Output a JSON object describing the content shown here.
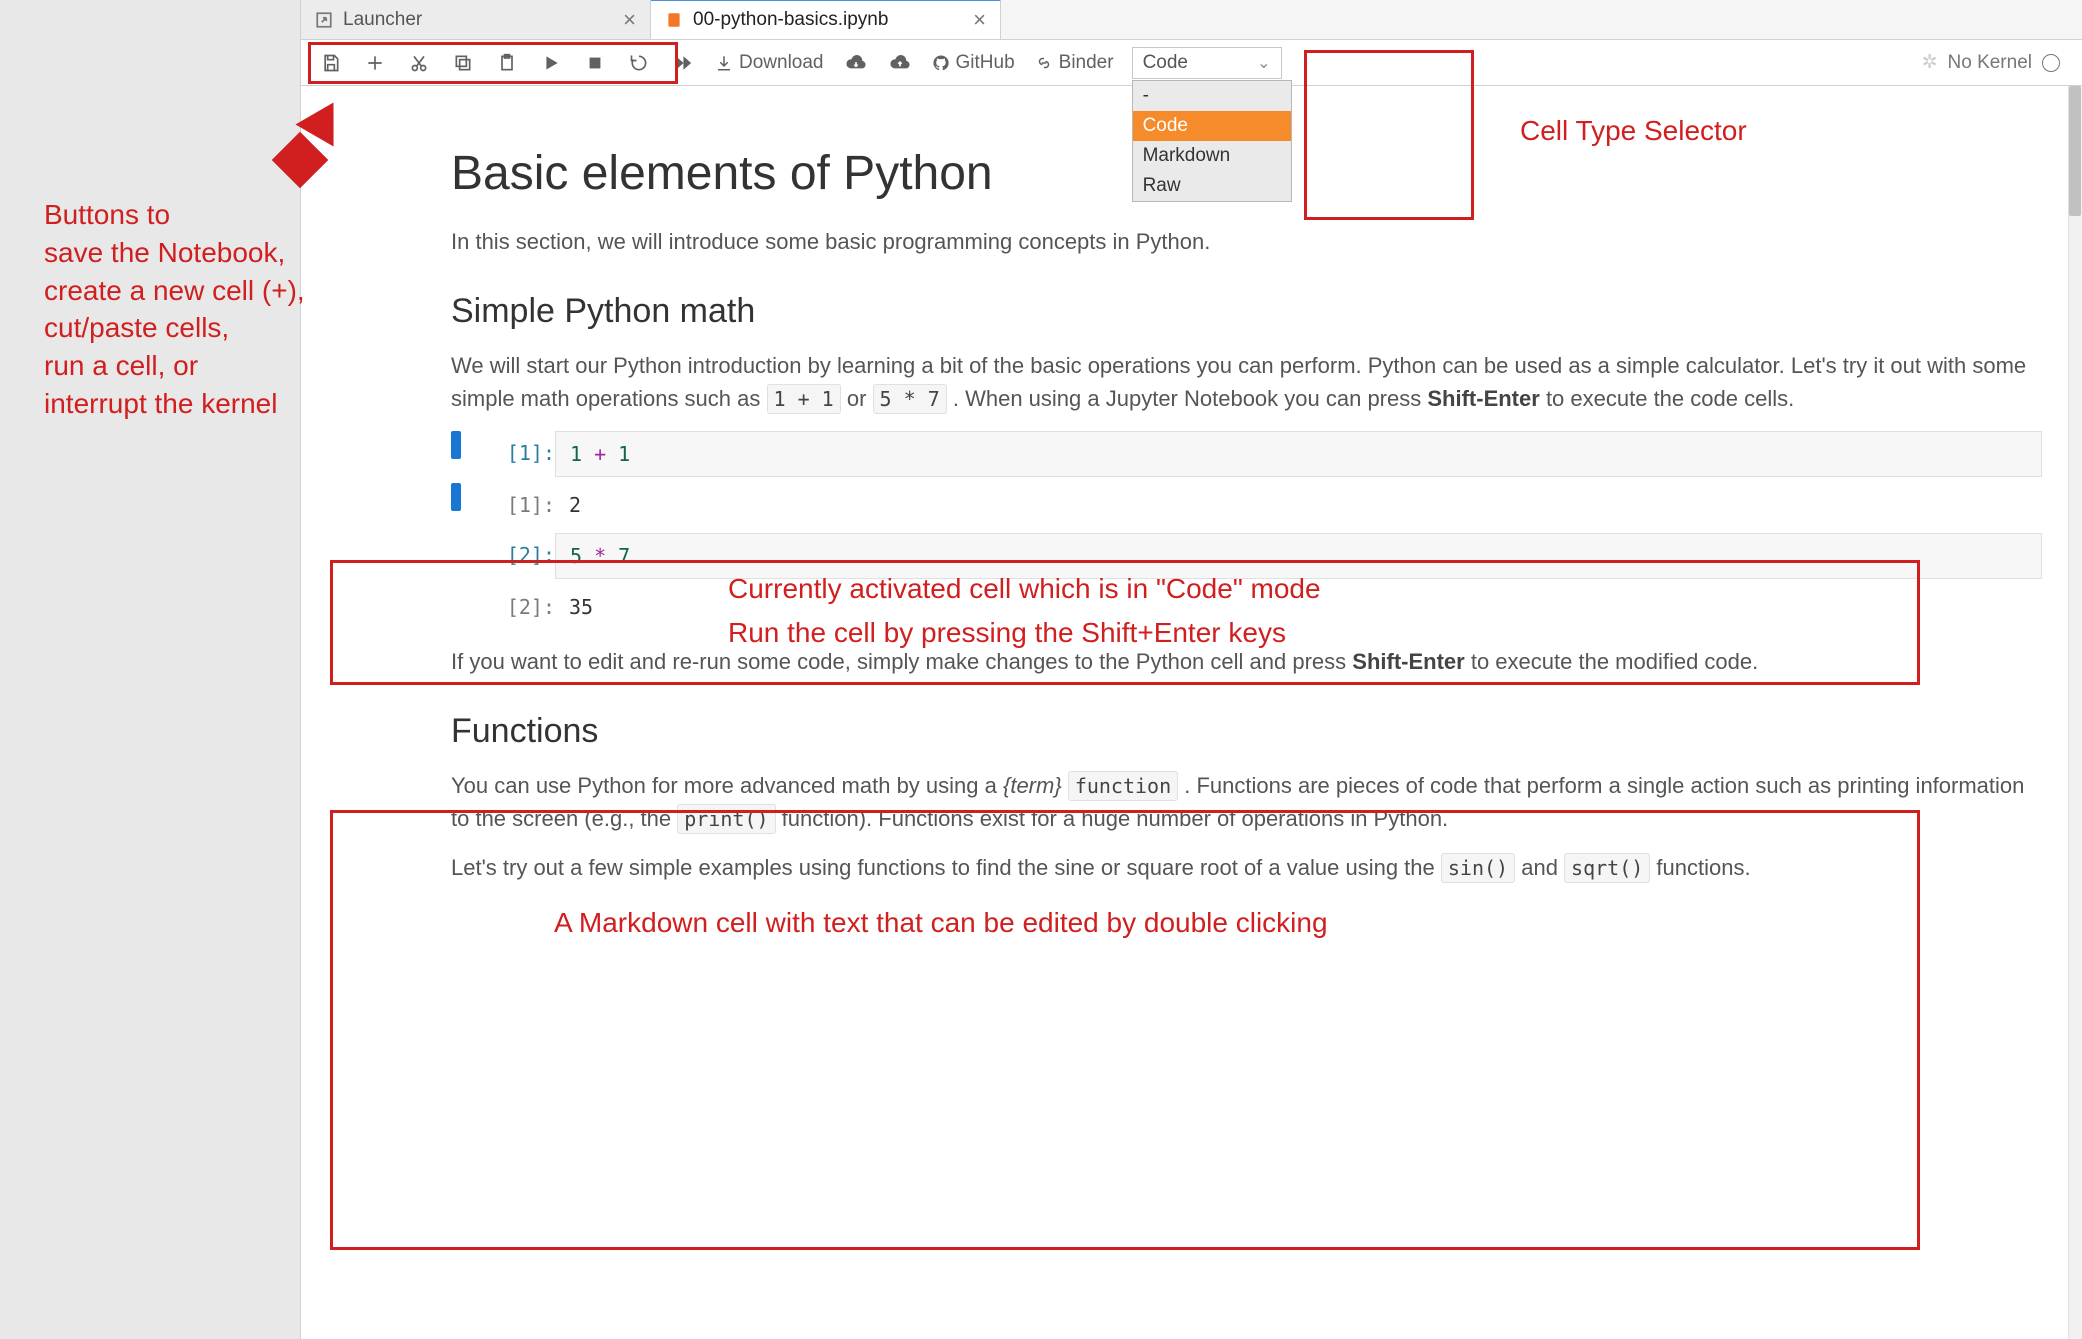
{
  "tabs": [
    {
      "label": "Launcher",
      "icon": "launcher"
    },
    {
      "label": "00-python-basics.ipynb",
      "icon": "notebook"
    }
  ],
  "toolbar": {
    "download_label": "Download",
    "github_label": "GitHub",
    "binder_label": "Binder"
  },
  "celltype": {
    "current": "Code",
    "options": [
      "-",
      "Code",
      "Markdown",
      "Raw"
    ]
  },
  "kernel": {
    "status": "No Kernel"
  },
  "content": {
    "h1": "Basic elements of Python",
    "p1": "In this section, we will introduce some basic programming concepts in Python.",
    "h2a": "Simple Python math",
    "p2_pre": "We will start our Python introduction by learning a bit of the basic operations you can perform. Python can be used as a simple calculator. Let's try it out with some simple math operations such as ",
    "code1": "1 + 1",
    "p2_mid": " or ",
    "code2": "5 * 7",
    "p2_post": " . When using a Jupyter Notebook you can press ",
    "bold1": "Shift-Enter",
    "p2_end": " to execute the code cells.",
    "cell1_in_prompt": "[1]:",
    "cell1_in_code_a": "1",
    "cell1_in_code_op": " + ",
    "cell1_in_code_b": "1",
    "cell1_out_prompt": "[1]:",
    "cell1_out": "2",
    "cell2_in_prompt": "[2]:",
    "cell2_in_code_a": "5",
    "cell2_in_code_op": " * ",
    "cell2_in_code_b": "7",
    "cell2_out_prompt": "[2]:",
    "cell2_out": "35",
    "p3_pre": "If you want to edit and re-run some code, simply make changes to the Python cell and press ",
    "bold2": "Shift-Enter",
    "p3_post": " to execute the modified code.",
    "h2b": "Functions",
    "p4_pre": "You can use Python for more advanced math by using a ",
    "term": "{term}",
    "code_func": "function",
    "p4_mid": " . Functions are pieces of code that perform a single action such as printing information to the screen (e.g., the ",
    "code_print": "print()",
    "p4_post": " function). Functions exist for a huge number of operations in Python.",
    "p5_pre": "Let's try out a few simple examples using functions to find the sine or square root of a value using the ",
    "code_sin": "sin()",
    "p5_mid": " and ",
    "code_sqrt": "sqrt()",
    "p5_post": " functions."
  },
  "annotations": {
    "toolbar_buttons": "Buttons to\nsave the Notebook,\ncreate a new cell (+),\ncut/paste cells,\nrun a cell, or\ninterrupt the kernel",
    "celltype_label": "Cell Type Selector",
    "active_cell_a": "Currently activated cell which is in \"Code\" mode",
    "active_cell_b": "Run the cell by pressing the Shift+Enter keys",
    "markdown_cell": "A Markdown cell with text that can be edited by double clicking"
  }
}
